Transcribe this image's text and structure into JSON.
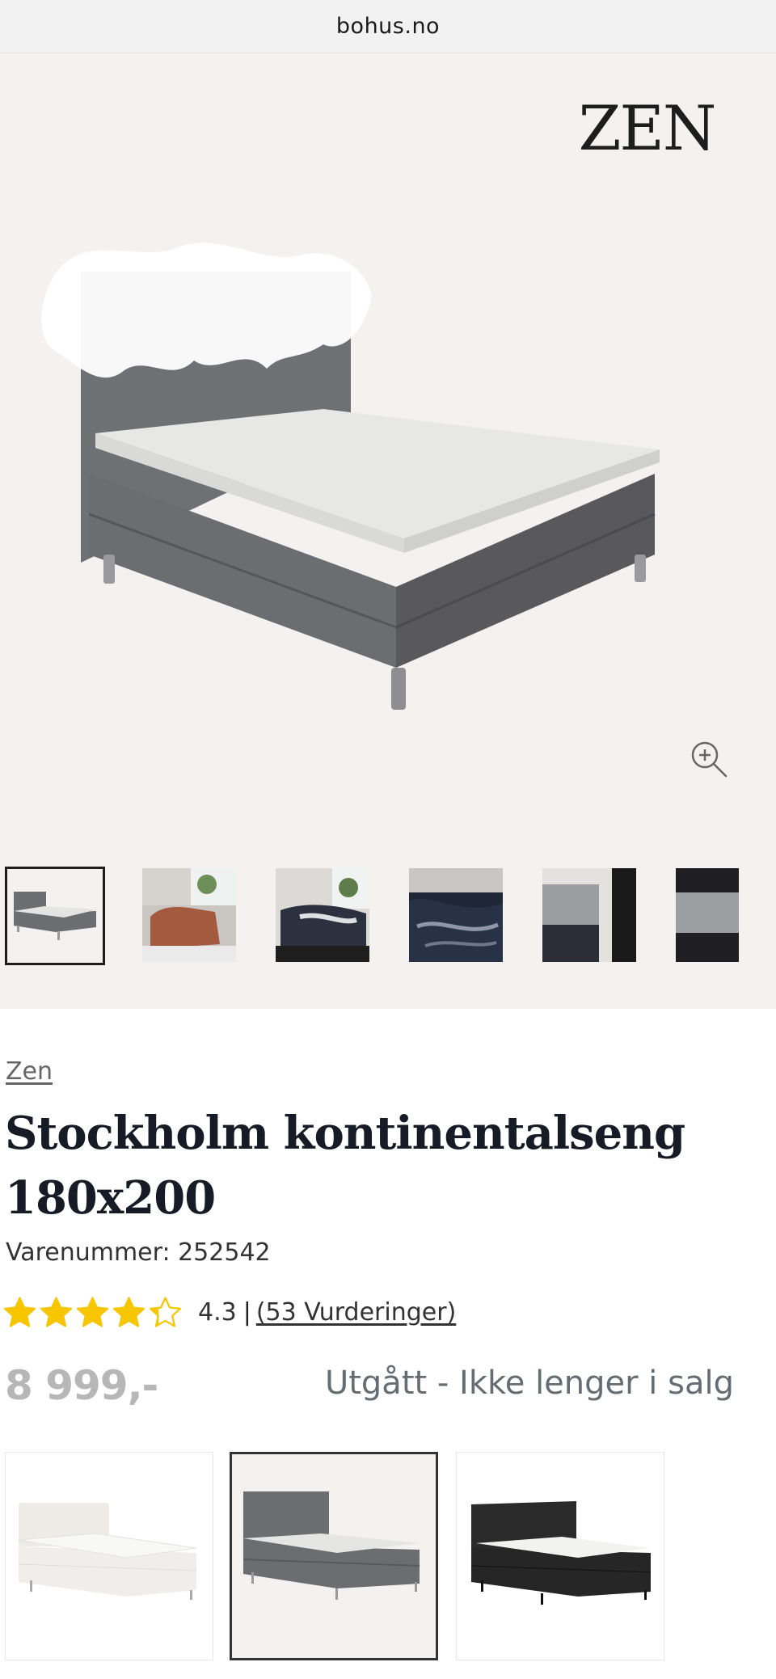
{
  "browser": {
    "url": "bohus.no"
  },
  "product": {
    "brand_logo": "ZEN",
    "vendor": "Zen",
    "title": "Stockholm kontinentalseng 180x200",
    "sku": "Varenummer: 252542",
    "rating": 4.3,
    "rating_text": "4.3",
    "rating_separator": "|",
    "reviews_text": "(53 Vurderinger)",
    "price": "8 999,-",
    "status": "Utgått - Ikke lenger i salg"
  },
  "gallery": {
    "thumbnails": [
      {
        "name": "thumb-grey-bed",
        "active": true
      },
      {
        "name": "thumb-rust-bedding"
      },
      {
        "name": "thumb-dark-bedding"
      },
      {
        "name": "thumb-navy-bedding"
      },
      {
        "name": "thumb-headboard-closeup"
      },
      {
        "name": "thumb-fabric-closeup"
      }
    ],
    "zoom_icon": "zoom-in-icon"
  },
  "variants": [
    {
      "name": "variant-white",
      "selected": false
    },
    {
      "name": "variant-grey",
      "selected": true
    },
    {
      "name": "variant-black",
      "selected": false
    }
  ],
  "colors": {
    "star": "#f7c600",
    "price_disabled": "#b7b7b7",
    "status": "#656d74",
    "bed_grey": "#6c6d70",
    "mattress": "#e5e5e3"
  }
}
